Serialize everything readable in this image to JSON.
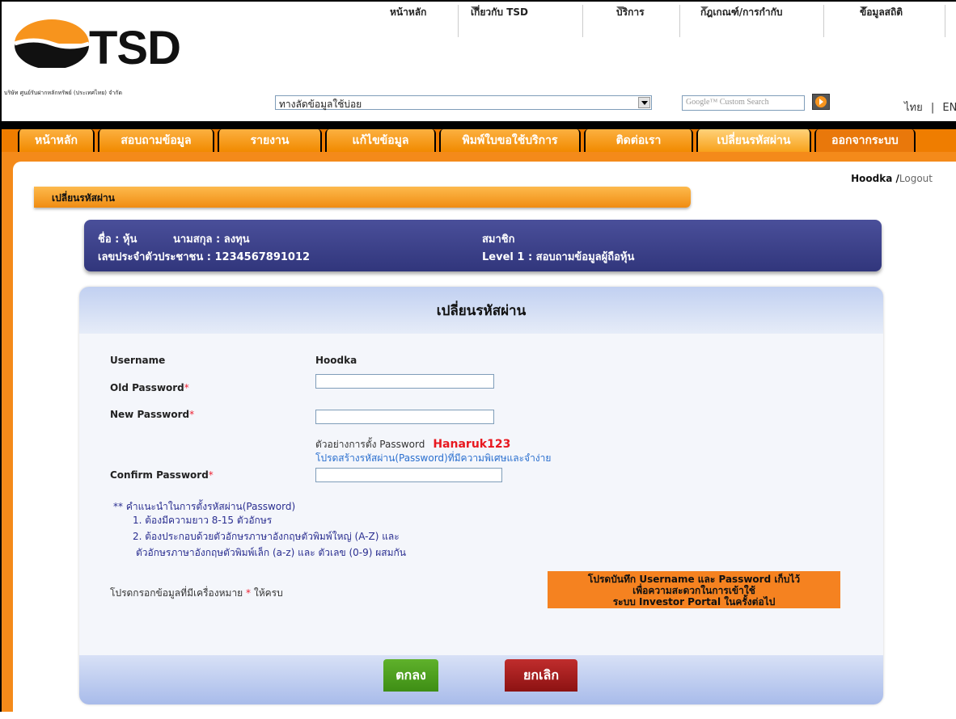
{
  "header": {
    "brand": "TSD",
    "company": "บริษัท ศูนย์รับฝากหลักทรัพย์ (ประเทศไทย) จำกัด",
    "top_nav": [
      "หน้าหลัก",
      "เกี่ยวกับ TSD",
      "บริการ",
      "กฎเกณฑ์/การกำกับ",
      "ข้อมูลสถิติ"
    ],
    "quick_links_value": "ทางลัดข้อมูลใช้บ่อย",
    "search_placeholder": "Google™ Custom Search",
    "lang_th": "ไทย",
    "lang_sep": "|",
    "lang_en": "ENG"
  },
  "main_nav": [
    "หน้าหลัก",
    "สอบถามข้อมูล",
    "รายงาน",
    "แก้ไขข้อมูล",
    "พิมพ์ใบขอใช้บริการ",
    "ติดต่อเรา",
    "เปลี่ยนรหัสผ่าน",
    "ออกจากระบบ"
  ],
  "user": {
    "name": "Hoodka",
    "sep": " /",
    "logout": "Logout"
  },
  "section_title": "เปลี่ยนรหัสผ่าน",
  "info": {
    "first_name": "ชื่อ : หุ้น",
    "last_name": "นามสกุล : ลงทุน",
    "id_card": "เลขประจำตัวประชาชน : 1234567891012",
    "member": "สมาชิก",
    "level": "Level 1   :  สอบถามข้อมูลผู้ถือหุ้น"
  },
  "form": {
    "title": "เปลี่ยนรหัสผ่าน",
    "username_label": "Username",
    "username_value": "Hoodka",
    "old_password_label": "Old Password",
    "new_password_label": "New Password",
    "confirm_password_label": "Confirm Password",
    "required_mark": "*",
    "example_label": "ตัวอย่างการตั้ง Password",
    "example_value": "Hanaruk123",
    "example_hint": "โปรดสร้างรหัสผ่าน(Password)ที่มีความพิเศษและจำง่าย",
    "tips_title": "** คำแนะนำในการตั้งรหัสผ่าน(Password)",
    "tip1": "1. ต้องมีความยาว 8-15 ตัวอักษร",
    "tip2": "2. ต้องประกอบด้วยตัวอักษรภาษาอังกฤษตัวพิมพ์ใหญ่ (A-Z) และ",
    "tip2b": "ตัวอักษรภาษาอังกฤษตัวพิมพ์เล็ก (a-z) และ ตัวเลข (0-9) ผสมกัน",
    "required_note_a": "โปรดกรอกข้อมูลที่มีเครื่องหมาย",
    "required_note_b": "ให้ครบ",
    "notice_1": "โปรดบันทึก Username และ Password เก็บไว้",
    "notice_2": "เพื่อความสะดวกในการเข้าใช้",
    "notice_3": "ระบบ Investor Portal ในครั้งต่อไป",
    "ok_label": "ตกลง",
    "cancel_label": "ยกเลิก"
  },
  "colors": {
    "accent": "#f48a1a",
    "info_bg": "#3a3f88",
    "ok": "#4a9e1d",
    "cancel": "#a01f1f",
    "alert_text": "#e8181f"
  }
}
